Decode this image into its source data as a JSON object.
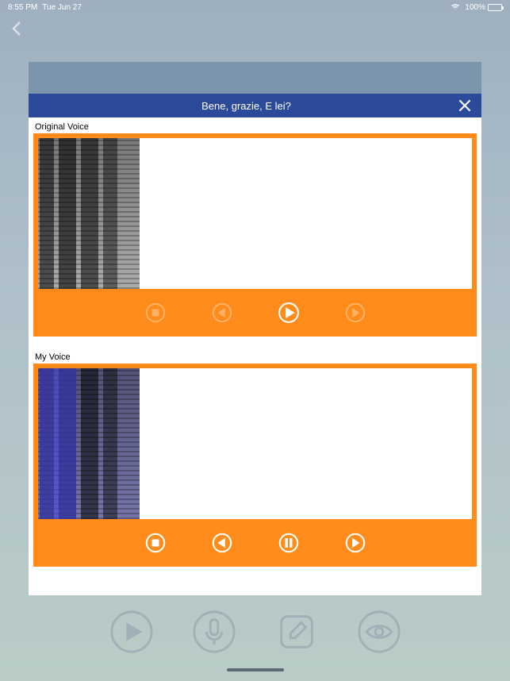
{
  "status": {
    "time": "8:55 PM",
    "date": "Tue Jun 27",
    "battery_pct": "100%"
  },
  "modal": {
    "title": "Bene, grazie, E lei?",
    "section_original": "Original Voice",
    "section_my": "My Voice"
  },
  "icons": {
    "back": "chevron-left-icon",
    "close": "close-icon",
    "stop": "stop-icon",
    "prev": "previous-icon",
    "play": "play-icon",
    "pause": "pause-icon",
    "next": "next-icon",
    "tool_play": "play-circle-icon",
    "tool_mic": "microphone-icon",
    "tool_edit": "edit-icon",
    "tool_eye": "eye-icon"
  }
}
